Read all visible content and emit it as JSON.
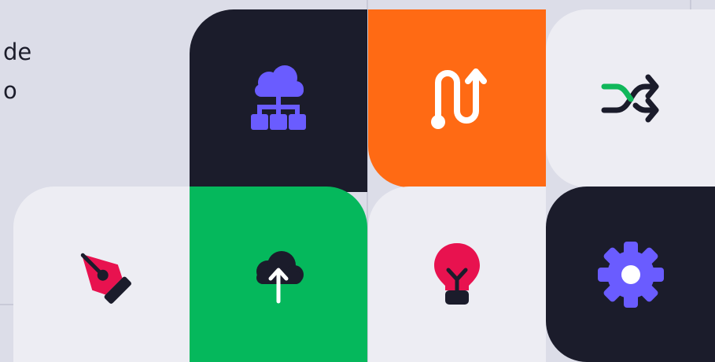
{
  "text_fragments": [
    "de",
    "o"
  ],
  "tiles": [
    {
      "id": "cloud-network",
      "icon": "cloud-network-icon",
      "background": "#1b1c2b",
      "icon_color": "#6a5cff"
    },
    {
      "id": "route",
      "icon": "route-icon",
      "background": "#ff6a14",
      "icon_color": "#ffffff"
    },
    {
      "id": "shuffle",
      "icon": "shuffle-icon",
      "background": "#ededf3",
      "icon_colors": [
        "#1b1c2b",
        "#10b75a"
      ]
    },
    {
      "id": "pen-tool",
      "icon": "pen-nib-icon",
      "background": "#ededf3",
      "icon_colors": [
        "#e8124f",
        "#1b1c2b"
      ]
    },
    {
      "id": "cloud-upload",
      "icon": "cloud-upload-icon",
      "background": "#05b85c",
      "icon_color": "#1b1c2b"
    },
    {
      "id": "lightbulb",
      "icon": "lightbulb-icon",
      "background": "#ededf3",
      "icon_colors": [
        "#e8124f",
        "#1b1c2b"
      ]
    },
    {
      "id": "settings",
      "icon": "gear-icon",
      "background": "#1b1c2b",
      "icon_color": "#6a5cff"
    }
  ]
}
